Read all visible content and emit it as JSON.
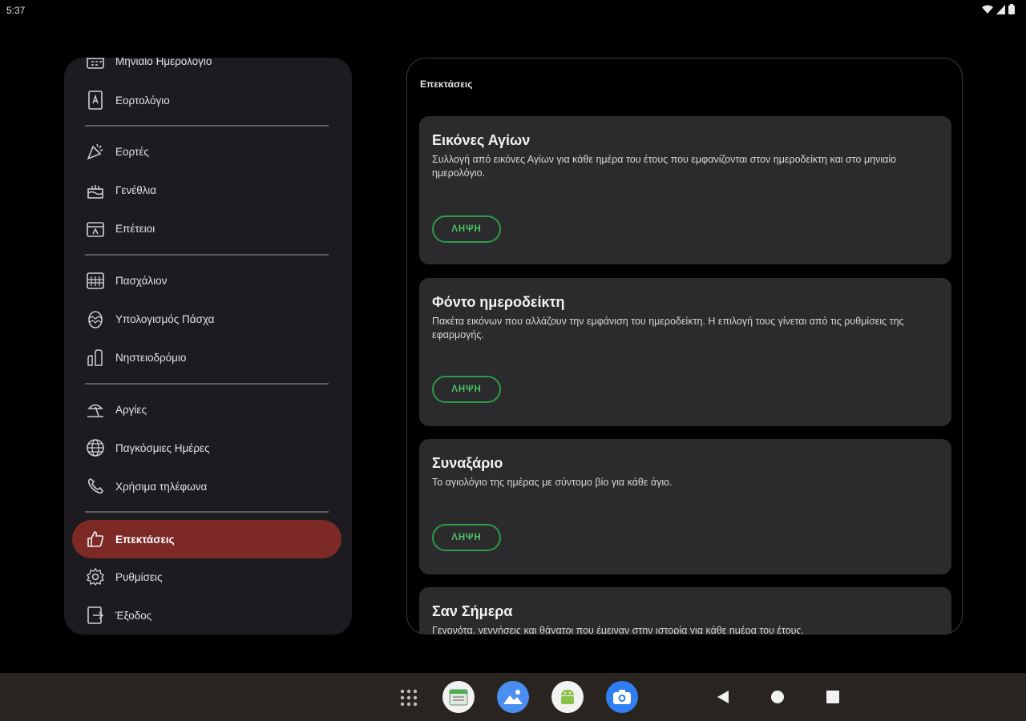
{
  "status_bar": {
    "time": "5:37"
  },
  "drawer": {
    "items": [
      {
        "label": "Μηνιαίο Ημερολόγιο",
        "icon": "calendar-icon"
      },
      {
        "label": "Εορτολόγιο",
        "icon": "book-icon"
      },
      {
        "label": "Εορτές",
        "icon": "party-icon"
      },
      {
        "label": "Γενέθλια",
        "icon": "cake-icon"
      },
      {
        "label": "Επέτειοι",
        "icon": "anniversary-icon"
      },
      {
        "label": "Πασχάλιον",
        "icon": "paschal-calendar-icon"
      },
      {
        "label": "Υπολογισμός Πάσχα",
        "icon": "easter-egg-icon"
      },
      {
        "label": "Νηστειοδρόμιο",
        "icon": "fasting-icon"
      },
      {
        "label": "Αργίες",
        "icon": "holiday-icon"
      },
      {
        "label": "Παγκόσμιες Ημέρες",
        "icon": "globe-icon"
      },
      {
        "label": "Χρήσιμα τηλέφωνα",
        "icon": "phone-icon"
      },
      {
        "label": "Επεκτάσεις",
        "icon": "thumbs-up-icon",
        "active": true
      },
      {
        "label": "Ρυθμίσεις",
        "icon": "gear-icon"
      },
      {
        "label": "Έξοδος",
        "icon": "exit-icon"
      }
    ]
  },
  "extensions": {
    "title": "Επεκτάσεις",
    "cards": [
      {
        "title": "Εικόνες Αγίων",
        "description": "Συλλογή από εικόνες Αγίων για κάθε ημέρα του έτους που εμφανίζονται στον ημεροδείκτη και στο μηνιαίο ημερολόγιο.",
        "button": "ΛΗΨΗ"
      },
      {
        "title": "Φόντο ημεροδείκτη",
        "description": "Πακέτα εικόνων που αλλάζουν την εμφάνιση του ημεροδείκτη. Η επιλογή τους γίνεται από τις ρυθμίσεις της εφαρμογής.",
        "button": "ΛΗΨΗ"
      },
      {
        "title": "Συναξάριο",
        "description": "Το αγιολόγιο της ημέρας με σύντομο βίο για κάθε άγιο.",
        "button": "ΛΗΨΗ"
      },
      {
        "title": "Σαν Σήμερα",
        "description": "Γεγονότα, γεννήσεις και θάνατοι που έμειναν στην ιστορία για κάθε ημέρα του έτους."
      }
    ]
  },
  "dock": {
    "apps": [
      {
        "icon": "calendar-app-icon"
      },
      {
        "icon": "photos-app-icon"
      },
      {
        "icon": "android-app-icon"
      },
      {
        "icon": "camera-app-icon"
      }
    ]
  },
  "colors": {
    "active_nav": "#7d2a27",
    "button_green": "#4cc463",
    "card_background": "#2b2b2e",
    "drawer_background": "#1c1b1f"
  }
}
